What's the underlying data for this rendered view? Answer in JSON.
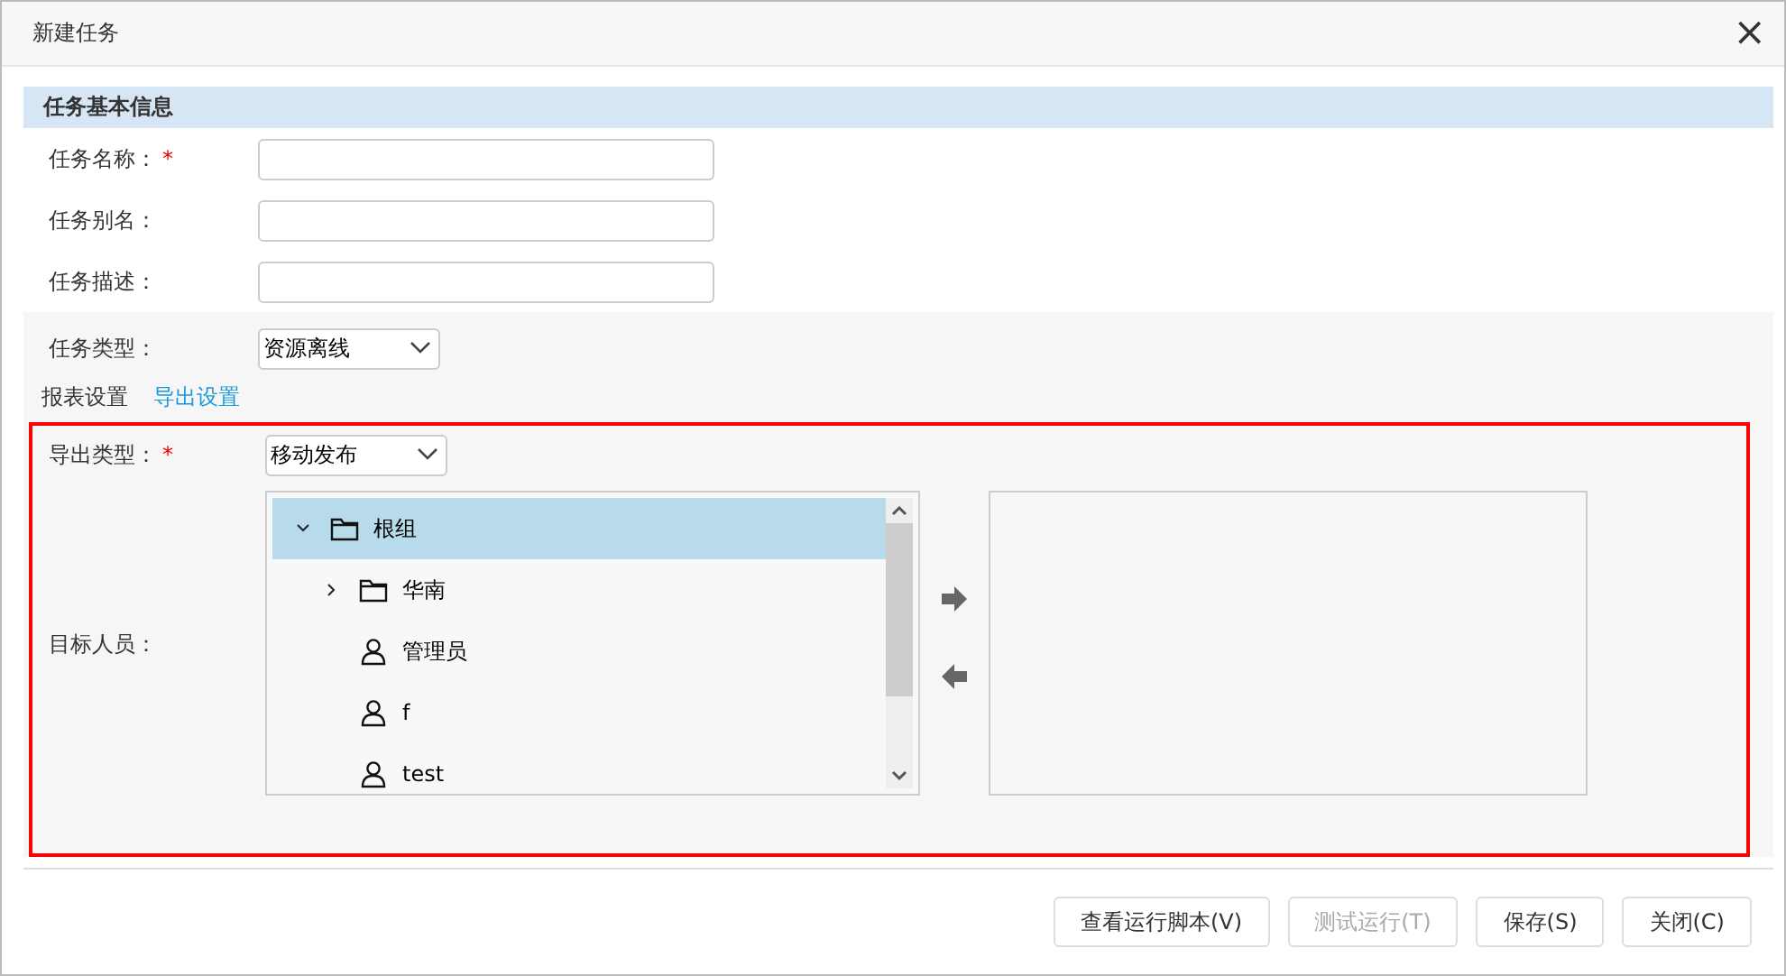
{
  "window": {
    "title": "新建任务",
    "close": "×"
  },
  "section": {
    "title": "任务基本信息"
  },
  "required_mark": "*",
  "fields": [
    {
      "label": "任务名称：",
      "required": true
    },
    {
      "label": "任务别名：",
      "required": false
    },
    {
      "label": "任务描述：",
      "required": false
    }
  ],
  "task_type": {
    "label": "任务类型：",
    "value": "资源离线"
  },
  "tabs": [
    {
      "label": "报表设置",
      "selected": false
    },
    {
      "label": "导出设置",
      "selected": true
    }
  ],
  "export": {
    "label": "导出类型：",
    "required": true,
    "value": "移动发布",
    "target_label": "目标人员：",
    "tree": [
      {
        "kind": "folder",
        "label": "根组",
        "expanded": true,
        "selected": true,
        "children": [
          {
            "kind": "folder",
            "label": "华南",
            "expanded": false,
            "selected": false
          },
          {
            "kind": "user",
            "label": "管理员",
            "selected": false
          },
          {
            "kind": "user",
            "label": "f",
            "selected": false
          },
          {
            "kind": "user",
            "label": "test",
            "selected": false
          }
        ]
      }
    ]
  },
  "buttons": [
    {
      "label": "查看运行脚本(V)",
      "disabled": false
    },
    {
      "label": "测试运行(T)",
      "disabled": true
    },
    {
      "label": "保存(S)",
      "disabled": false
    },
    {
      "label": "关闭(C)",
      "disabled": false
    }
  ]
}
